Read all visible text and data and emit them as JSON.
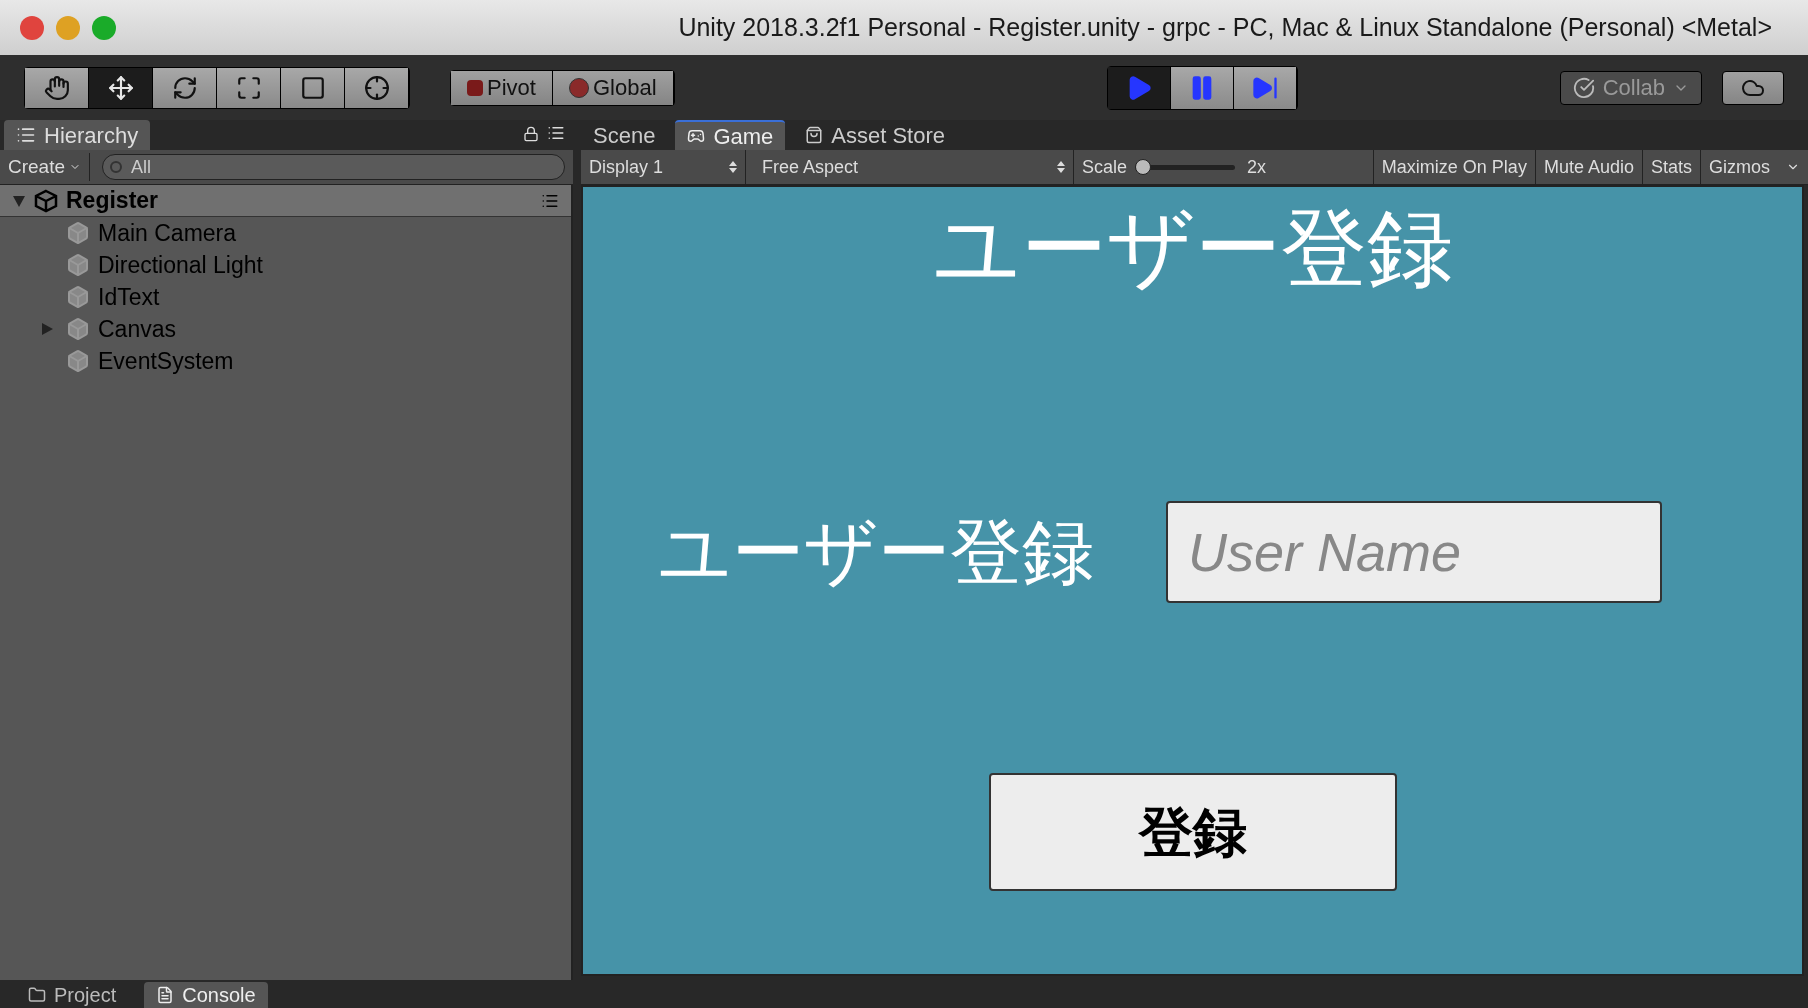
{
  "window": {
    "title": "Unity 2018.3.2f1 Personal - Register.unity - grpc - PC, Mac & Linux Standalone (Personal) <Metal>"
  },
  "tools": [
    {
      "kind": "hand",
      "selected": false
    },
    {
      "kind": "move",
      "selected": true
    },
    {
      "kind": "rotate",
      "selected": false
    },
    {
      "kind": "scale",
      "selected": false
    },
    {
      "kind": "rect",
      "selected": false
    },
    {
      "kind": "transform",
      "selected": false
    }
  ],
  "pivot_buttons": [
    {
      "kind": "pivot",
      "label": "Pivot"
    },
    {
      "kind": "global",
      "label": "Global"
    }
  ],
  "playback": [
    {
      "kind": "play",
      "selected": true
    },
    {
      "kind": "pause",
      "selected": false
    },
    {
      "kind": "step",
      "selected": false
    }
  ],
  "collab": {
    "label": "Collab"
  },
  "hierarchy": {
    "tab": "Hierarchy",
    "create": "Create",
    "search": {
      "placeholder": "All"
    },
    "scene": {
      "name": "Register",
      "expanded": true,
      "children": [
        {
          "name": "Main Camera",
          "expandable": false
        },
        {
          "name": "Directional Light",
          "expandable": false
        },
        {
          "name": "IdText",
          "expandable": false
        },
        {
          "name": "Canvas",
          "expandable": true
        },
        {
          "name": "EventSystem",
          "expandable": false
        }
      ]
    }
  },
  "view_tabs": [
    {
      "kind": "scene",
      "label": "Scene",
      "selected": false
    },
    {
      "kind": "game",
      "label": "Game",
      "selected": true
    },
    {
      "kind": "store",
      "label": "Asset Store",
      "selected": false
    }
  ],
  "game_toolbar": {
    "display": "Display 1",
    "aspect": "Free Aspect",
    "scale_label": "Scale",
    "scale": {
      "level": 0
    },
    "scale_reading": "2x",
    "toggles": [
      {
        "label": "Maximize On Play",
        "on": false
      },
      {
        "label": "Mute Audio",
        "on": false
      },
      {
        "label": "Stats",
        "on": false
      },
      {
        "label": "Gizmos",
        "on": false
      }
    ]
  },
  "game_view": {
    "heading": "ユーザー登録",
    "field_label": "ユーザー登録",
    "input": {
      "placeholder": "User Name"
    },
    "submit": "登録"
  },
  "bottom_tabs": [
    {
      "kind": "project",
      "label": "Project",
      "selected": false
    },
    {
      "kind": "console",
      "label": "Console",
      "selected": true
    }
  ]
}
